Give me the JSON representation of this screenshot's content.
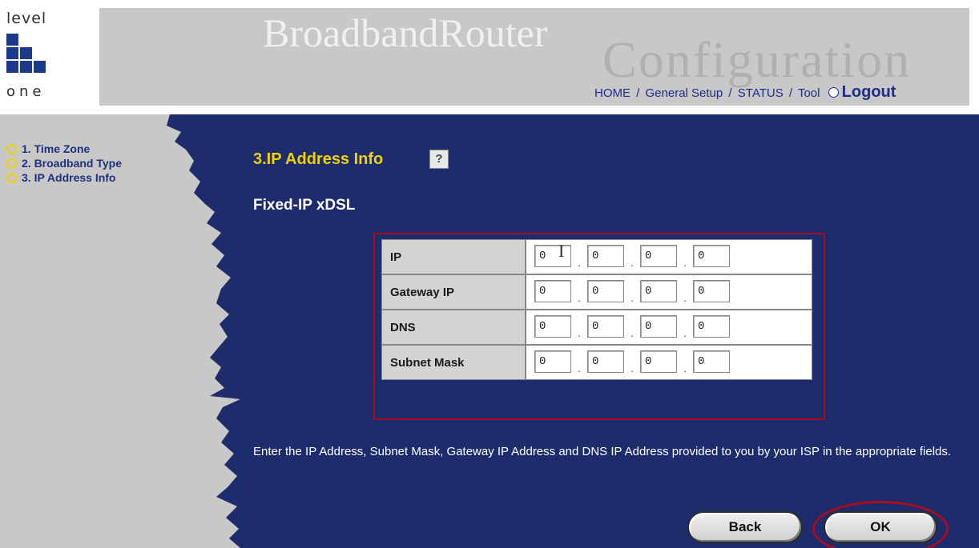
{
  "header": {
    "logo": {
      "top_text": "level",
      "bottom_text": "one"
    },
    "brand_title": "BroadbandRouter",
    "brand_subtitle": "Configuration",
    "nav": {
      "home": "HOME",
      "general_setup": "General Setup",
      "status": "STATUS",
      "tool": "Tool",
      "separator": "/",
      "logout": "Logout"
    }
  },
  "sidebar": {
    "items": [
      {
        "label": "1. Time Zone"
      },
      {
        "label": "2. Broadband Type"
      },
      {
        "label": "3. IP Address Info"
      }
    ]
  },
  "main": {
    "section_title": "3.IP Address Info",
    "help_icon": "?",
    "subtitle": "Fixed-IP xDSL",
    "rows": [
      {
        "label": "IP",
        "octets": [
          "0",
          "0",
          "0",
          "0"
        ]
      },
      {
        "label": "Gateway IP",
        "octets": [
          "0",
          "0",
          "0",
          "0"
        ]
      },
      {
        "label": "DNS",
        "octets": [
          "0",
          "0",
          "0",
          "0"
        ]
      },
      {
        "label": "Subnet Mask",
        "octets": [
          "0",
          "0",
          "0",
          "0"
        ]
      }
    ],
    "octet_separator": ".",
    "description": "Enter the IP Address, Subnet Mask, Gateway IP Address and DNS IP Address provided to you by your ISP in the appropriate fields.",
    "back_label": "Back",
    "ok_label": "OK"
  },
  "colors": {
    "main_bg": "#1d2c6c",
    "sidebar_bg": "#c8c8c8",
    "title_yellow": "#f2d200",
    "highlight_red": "#aa0b1e",
    "nav_blue": "#1d2c88"
  }
}
